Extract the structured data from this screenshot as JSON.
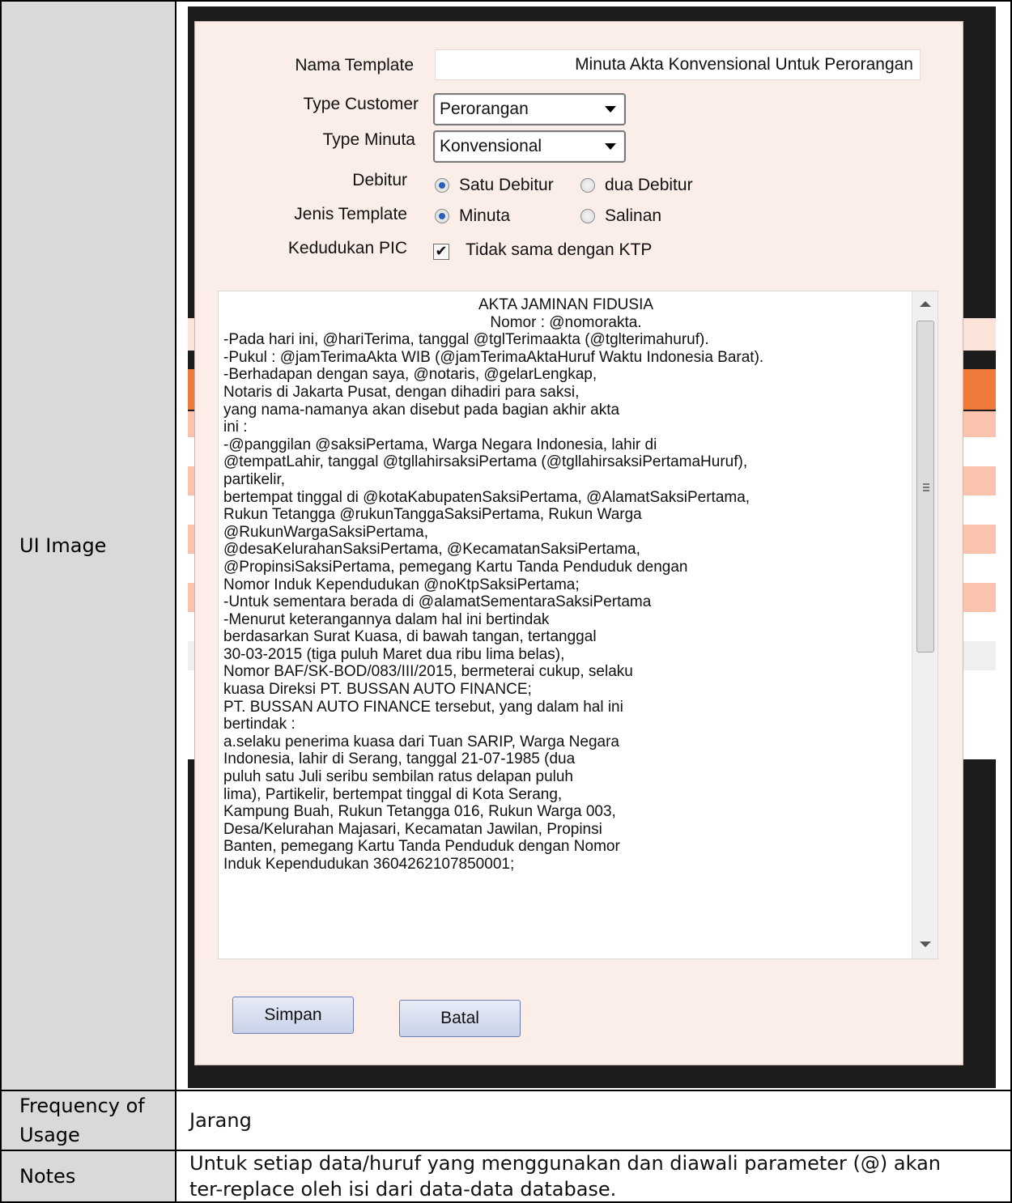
{
  "table": {
    "rows": [
      {
        "label": "UI Image"
      },
      {
        "label": "Frequency of Usage",
        "value": "Jarang"
      },
      {
        "label": "Notes",
        "value": "Untuk setiap data/huruf yang menggunakan dan diawali parameter (@) akan ter-replace oleh isi dari data-data database."
      }
    ]
  },
  "form": {
    "nama_template_label": "Nama Template",
    "nama_template_value": "Minuta Akta Konvensional Untuk Perorangan",
    "type_customer_label": "Type Customer",
    "type_customer_value": "Perorangan",
    "type_minuta_label": "Type Minuta",
    "type_minuta_value": "Konvensional",
    "debitur_label": "Debitur",
    "debitur_option_1": "Satu Debitur",
    "debitur_option_2": "dua Debitur",
    "debitur_selected": "Satu Debitur",
    "jenis_label": "Jenis Template",
    "jenis_option_1": "Minuta",
    "jenis_option_2": "Salinan",
    "jenis_selected": "Minuta",
    "kedudukan_label": "Kedudukan PIC",
    "kedudukan_checkbox_label": "Tidak sama dengan KTP",
    "kedudukan_checked": true
  },
  "template_text": {
    "lines": [
      "AKTA JAMINAN FIDUSIA",
      "Nomor : @nomorakta.",
      "-Pada hari ini, @hariTerima, tanggal @tglTerimaakta (@tglterimahuruf).",
      "-Pukul : @jamTerimaAkta WIB (@jamTerimaAktaHuruf Waktu Indonesia Barat).",
      "-Berhadapan dengan saya, @notaris, @gelarLengkap,",
      "Notaris di Jakarta Pusat, dengan dihadiri para saksi,",
      "yang nama-namanya akan disebut pada bagian akhir akta",
      "ini :",
      "-@panggilan @saksiPertama, Warga Negara Indonesia, lahir di",
      "@tempatLahir, tanggal @tgllahirsaksiPertama (@tgllahirsaksiPertamaHuruf),",
      "partikelir,",
      "bertempat tinggal di @kotaKabupatenSaksiPertama, @AlamatSaksiPertama,",
      "Rukun Tetangga @rukunTanggaSaksiPertama, Rukun Warga",
      "@RukunWargaSaksiPertama,",
      "@desaKelurahanSaksiPertama, @KecamatanSaksiPertama,",
      "@PropinsiSaksiPertama, pemegang Kartu Tanda Penduduk dengan",
      "Nomor Induk Kependudukan @noKtpSaksiPertama;",
      "-Untuk sementara berada di @alamatSementaraSaksiPertama",
      "-Menurut keterangannya dalam hal ini bertindak",
      "berdasarkan Surat Kuasa, di bawah tangan, tertanggal",
      "30-03-2015 (tiga puluh Maret dua ribu lima belas),",
      "Nomor BAF/SK-BOD/083/III/2015, bermeterai cukup, selaku",
      "kuasa Direksi PT. BUSSAN AUTO FINANCE;",
      "PT. BUSSAN AUTO FINANCE tersebut, yang dalam hal ini",
      "bertindak :",
      "a.selaku penerima kuasa dari Tuan SARIP, Warga Negara",
      "Indonesia, lahir di Serang, tanggal 21-07-1985 (dua",
      "puluh satu Juli seribu sembilan ratus delapan puluh",
      "lima), Partikelir, bertempat tinggal di Kota Serang,",
      "Kampung Buah, Rukun Tetangga 016, Rukun Warga 003,",
      "Desa/Kelurahan Majasari, Kecamatan Jawilan, Propinsi",
      "Banten, pemegang Kartu Tanda Penduduk dengan Nomor",
      "Induk Kependudukan 3604262107850001;"
    ]
  },
  "buttons": {
    "simpan": "Simpan",
    "batal": "Batal"
  },
  "colors": {
    "label_shade": "#d9d9d9",
    "dialog_bg": "#fbeee9",
    "accent_orange": "#f07a3a",
    "row_salmon": "#fbc3ad",
    "radio_dot": "#2a5db8"
  }
}
